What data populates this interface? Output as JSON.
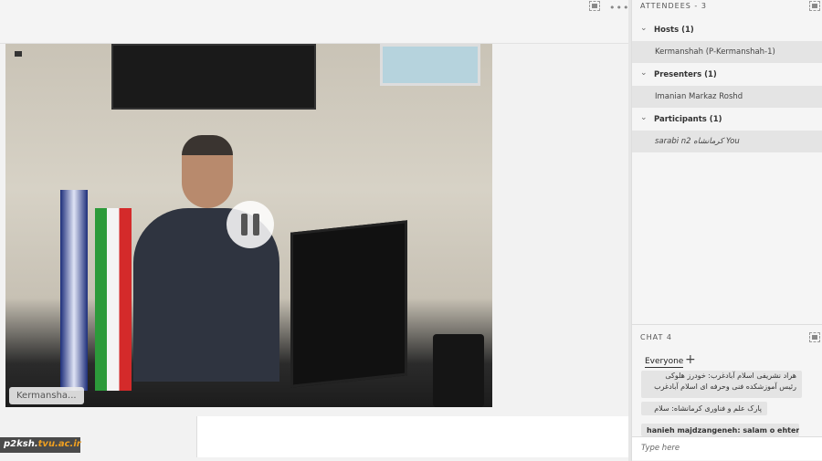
{
  "stage": {
    "video_name_tag": "Kermansha...",
    "watermark": {
      "prefix": "p2ksh.",
      "domain": "tvu.ac.ir"
    }
  },
  "attendees": {
    "title": "ATTENDEES - 3",
    "groups": [
      {
        "label": "Hosts (1)",
        "members": [
          "Kermanshah (P-Kermanshah-1)"
        ]
      },
      {
        "label": "Presenters (1)",
        "members": [
          "Imanian Markaz Roshd"
        ]
      },
      {
        "label": "Participants (1)",
        "members": [
          "sarabi n2 کرمانشاه You"
        ]
      }
    ]
  },
  "chat": {
    "title": "CHAT 4",
    "tab": "Everyone",
    "messages": [
      "هراد نشریفی اسلام آبادغرب: خودرز هلوکی رئیس آموزشکده فنی وحرفه ای اسلام آبادغرب",
      "پارک علم و فناوری کرمانشاه: سلام",
      "hanieh majdzangeneh: salam o ehteram"
    ],
    "input_placeholder": "Type here"
  }
}
